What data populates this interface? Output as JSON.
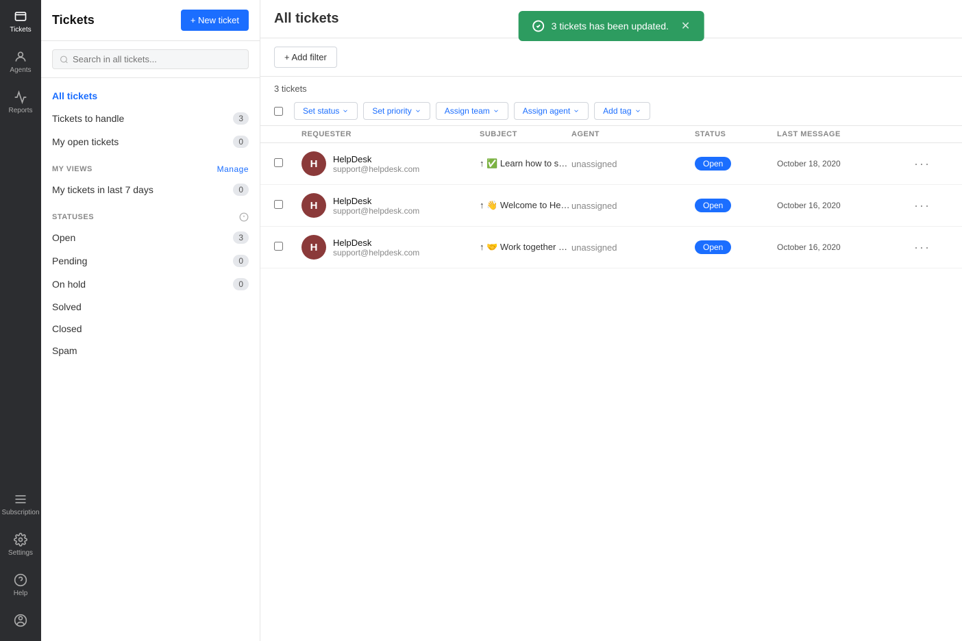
{
  "app": {
    "title": "Tickets"
  },
  "iconNav": {
    "items": [
      {
        "id": "tickets",
        "label": "Tickets",
        "active": true
      },
      {
        "id": "agents",
        "label": "Agents",
        "active": false
      },
      {
        "id": "reports",
        "label": "Reports",
        "active": false
      }
    ],
    "bottom": [
      {
        "id": "subscription",
        "label": "Subscription"
      },
      {
        "id": "settings",
        "label": "Settings"
      },
      {
        "id": "help",
        "label": "Help"
      },
      {
        "id": "profile",
        "label": "Profile"
      }
    ]
  },
  "sidebar": {
    "title": "Tickets",
    "newTicketBtn": "+ New ticket",
    "search": {
      "placeholder": "Search in all tickets..."
    },
    "allTicketsLabel": "All tickets",
    "navItems": [
      {
        "id": "tickets-to-handle",
        "label": "Tickets to handle",
        "count": "3"
      },
      {
        "id": "my-open-tickets",
        "label": "My open tickets",
        "count": "0"
      }
    ],
    "myViewsLabel": "MY VIEWS",
    "manageLabel": "Manage",
    "viewItems": [
      {
        "id": "my-tickets-last-7",
        "label": "My tickets in last 7 days",
        "count": "0"
      }
    ],
    "statusesLabel": "STATUSES",
    "statusItems": [
      {
        "id": "open",
        "label": "Open",
        "count": "3"
      },
      {
        "id": "pending",
        "label": "Pending",
        "count": "0"
      },
      {
        "id": "on-hold",
        "label": "On hold",
        "count": "0"
      },
      {
        "id": "solved",
        "label": "Solved",
        "count": ""
      },
      {
        "id": "closed",
        "label": "Closed",
        "count": ""
      },
      {
        "id": "spam",
        "label": "Spam",
        "count": ""
      }
    ]
  },
  "main": {
    "title": "All tickets",
    "toast": {
      "message": "3 tickets has been updated.",
      "visible": true
    },
    "addFilterBtn": "+ Add filter",
    "ticketsCount": "3 tickets",
    "bulkActions": {
      "setStatus": "Set status",
      "setPriority": "Set priority",
      "assignTeam": "Assign team",
      "assignAgent": "Assign agent",
      "addTag": "Add tag"
    },
    "tableHeaders": {
      "requester": "REQUESTER",
      "subject": "SUBJECT",
      "agent": "AGENT",
      "status": "STATUS",
      "lastMessage": "LAST MESSAGE"
    },
    "tickets": [
      {
        "id": "t1",
        "avatarLetter": "H",
        "requesterName": "HelpDesk",
        "requesterEmail": "support@helpdesk.com",
        "subjectEmoji": "↑ ✅",
        "subject": "Learn how to solve tickets effectively",
        "agent": "unassigned",
        "status": "Open",
        "lastMessage": "October 18, 2020"
      },
      {
        "id": "t2",
        "avatarLetter": "H",
        "requesterName": "HelpDesk",
        "requesterEmail": "support@helpdesk.com",
        "subjectEmoji": "↑ 👋",
        "subject": "Welcome to HelpDesk! Here's your next ...",
        "agent": "unassigned",
        "status": "Open",
        "lastMessage": "October 16, 2020"
      },
      {
        "id": "t3",
        "avatarLetter": "H",
        "requesterName": "HelpDesk",
        "requesterEmail": "support@helpdesk.com",
        "subjectEmoji": "↑ 🤝",
        "subject": "Work together with your team",
        "agent": "unassigned",
        "status": "Open",
        "lastMessage": "October 16, 2020"
      }
    ]
  }
}
